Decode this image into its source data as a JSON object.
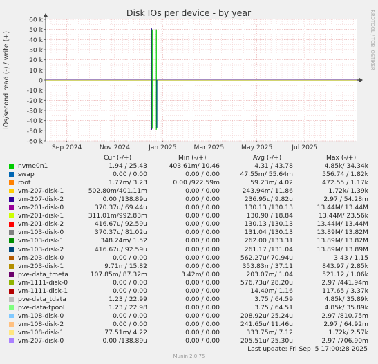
{
  "title": "Disk IOs per device - by year",
  "ylabel": "IOs/second read (-) / write (+)",
  "watermark": "RRDTOOL / TOBI OETIKER",
  "footer": "Munin 2.0.75",
  "last_update": "Last update: Fri Sep  5 17:00:28 2025",
  "legend_headers": [
    "Cur (-/+)",
    "Min (-/+)",
    "Avg (-/+)",
    "Max (-/+)"
  ],
  "chart_data": {
    "type": "line",
    "title": "Disk IOs per device - by year",
    "ylabel": "IOs/second read (-) / write (+)",
    "ylim": [
      -60000,
      60000
    ],
    "y_ticks": [
      "60 k",
      "50 k",
      "40 k",
      "30 k",
      "20 k",
      "10 k",
      "0",
      "-10 k",
      "-20 k",
      "-30 k",
      "-40 k",
      "-50 k",
      "-60 k"
    ],
    "y_tick_values": [
      60000,
      50000,
      40000,
      30000,
      20000,
      10000,
      0,
      -10000,
      -20000,
      -30000,
      -40000,
      -50000,
      -60000
    ],
    "x_ticks": [
      "Sep 2024",
      "Nov 2024",
      "Jan 2025",
      "Mar 2025",
      "May 2025",
      "Jul 2025"
    ],
    "x_range": [
      "2024-08-05",
      "2025-09-05"
    ],
    "x_tick_dates": [
      "2024-09-01",
      "2024-11-01",
      "2025-01-01",
      "2025-03-01",
      "2025-05-01",
      "2025-07-01"
    ],
    "grid": true,
    "series": [
      {
        "name": "nvme0n1",
        "color": "#00cc00",
        "cur": "1.94 / 25.43",
        "min": "403.61m/ 10.46",
        "avg": "4.31 / 43.78",
        "max": "4.85k/ 34.34k",
        "spikes": [
          {
            "date": "2024-12-18",
            "read": -49000,
            "write": 51000
          }
        ]
      },
      {
        "name": "swap",
        "color": "#0066b3",
        "cur": "0.00 / 0.00",
        "min": "0.00 / 0.00",
        "avg": "47.55m/ 55.64m",
        "max": "556.74 / 1.82k"
      },
      {
        "name": "root",
        "color": "#ff8000",
        "cur": "1.77m/ 3.23",
        "min": "0.00 /922.59m",
        "avg": "59.23m/ 4.02",
        "max": "472.55 / 1.17k"
      },
      {
        "name": "vm-207-disk-1",
        "color": "#ffcc00",
        "cur": "502.80m/401.11m",
        "min": "0.00 / 0.00",
        "avg": "243.94m/ 11.86",
        "max": "1.72k/ 1.39k"
      },
      {
        "name": "vm-207-disk-2",
        "color": "#330099",
        "cur": "0.00 /138.89u",
        "min": "0.00 / 0.00",
        "avg": "236.95u/ 9.82u",
        "max": "2.97 / 54.28m"
      },
      {
        "name": "vm-201-disk-0",
        "color": "#990099",
        "cur": "370.37u/ 69.44u",
        "min": "0.00 / 0.00",
        "avg": "130.13 /130.13",
        "max": "13.44M/ 13.44M"
      },
      {
        "name": "vm-201-disk-1",
        "color": "#ccff00",
        "cur": "311.01m/992.83m",
        "min": "0.00 / 0.00",
        "avg": "130.90 / 18.84",
        "max": "13.44M/ 23.56k"
      },
      {
        "name": "vm-201-disk-2",
        "color": "#ff0000",
        "cur": "416.67u/ 92.59u",
        "min": "0.00 / 0.00",
        "avg": "130.13 /130.13",
        "max": "13.44M/ 13.44M"
      },
      {
        "name": "vm-103-disk-0",
        "color": "#808080",
        "cur": "370.37u/ 81.02u",
        "min": "0.00 / 0.00",
        "avg": "131.04 /130.13",
        "max": "13.89M/ 13.82M"
      },
      {
        "name": "vm-103-disk-1",
        "color": "#008f00",
        "cur": "348.24m/ 1.52",
        "min": "0.00 / 0.00",
        "avg": "262.00 /133.31",
        "max": "13.89M/ 13.82M"
      },
      {
        "name": "vm-103-disk-2",
        "color": "#00487d",
        "cur": "416.67u/ 92.59u",
        "min": "0.00 / 0.00",
        "avg": "261.17 /131.04",
        "max": "13.89M/ 13.89M"
      },
      {
        "name": "vm-203-disk-0",
        "color": "#b35a00",
        "cur": "0.00 / 0.00",
        "min": "0.00 / 0.00",
        "avg": "562.27u/ 70.94u",
        "max": "3.43 / 1.15"
      },
      {
        "name": "vm-203-disk-1",
        "color": "#b38f00",
        "cur": "9.71m/ 15.82",
        "min": "0.00 / 0.00",
        "avg": "353.83m/ 37.11",
        "max": "843.97 / 2.85k"
      },
      {
        "name": "pve-data_tmeta",
        "color": "#6b006b",
        "cur": "107.85m/ 87.32m",
        "min": "3.42m/ 0.00",
        "avg": "203.07m/ 1.04",
        "max": "521.12 / 1.06k"
      },
      {
        "name": "vm-1111-disk-0",
        "color": "#8fb300",
        "cur": "0.00 / 0.00",
        "min": "0.00 / 0.00",
        "avg": "576.73u/ 28.20u",
        "max": "2.97 /441.94m"
      },
      {
        "name": "vm-1111-disk-1",
        "color": "#b30000",
        "cur": "0.00 / 0.00",
        "min": "0.00 / 0.00",
        "avg": "14.40m/ 1.16",
        "max": "117.65 / 3.37k"
      },
      {
        "name": "pve-data_tdata",
        "color": "#bebebe",
        "cur": "1.23 / 22.99",
        "min": "0.00 / 0.00",
        "avg": "3.75 / 64.59",
        "max": "4.85k/ 35.89k"
      },
      {
        "name": "pve-data-tpool",
        "color": "#80ff80",
        "cur": "1.23 / 22.98",
        "min": "0.00 / 0.00",
        "avg": "3.75 / 64.51",
        "max": "4.85k/ 35.89k"
      },
      {
        "name": "vm-108-disk-0",
        "color": "#80c9ff",
        "cur": "0.00 / 0.00",
        "min": "0.00 / 0.00",
        "avg": "208.92u/ 25.24u",
        "max": "2.97 /810.75m"
      },
      {
        "name": "vm-108-disk-2",
        "color": "#ffc080",
        "cur": "0.00 / 0.00",
        "min": "0.00 / 0.00",
        "avg": "241.65u/ 11.46u",
        "max": "2.97 / 64.92m"
      },
      {
        "name": "vm-108-disk-1",
        "color": "#ffe680",
        "cur": "77.51m/ 4.22",
        "min": "0.00 / 0.00",
        "avg": "333.75m/ 7.12",
        "max": "1.72k/ 2.57k"
      },
      {
        "name": "vm-207-disk-0",
        "color": "#aa80ff",
        "cur": "0.00 /138.89u",
        "min": "0.00 / 0.00",
        "avg": "205.51u/ 25.30u",
        "max": "2.97 /706.90m"
      }
    ],
    "spikes": [
      {
        "date": "2024-12-18",
        "read": -49000,
        "write": 51000,
        "color": "#330099"
      },
      {
        "date": "2024-12-18",
        "read": -48000,
        "write": 50000,
        "color": "#00cc00"
      },
      {
        "date": "2024-12-24",
        "read": -49000,
        "write": 50000,
        "color": "#00cc00"
      },
      {
        "date": "2024-12-24",
        "read": -47000,
        "write": 0,
        "color": "#00487d"
      }
    ]
  }
}
